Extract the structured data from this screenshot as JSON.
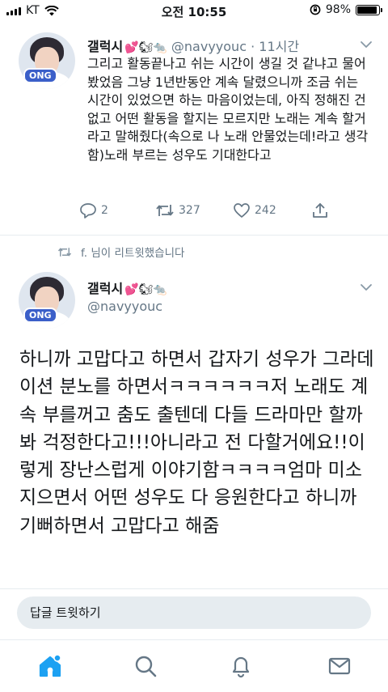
{
  "status_bar": {
    "carrier": "KT",
    "time": "오전 10:55",
    "battery": "98%",
    "battery_level": 0.98
  },
  "tweet": {
    "author_name": "갤럭시",
    "author_emoji": "💕🐿🐀",
    "handle": "@navyyouc",
    "time_separator": "·",
    "time_ago": "11시간",
    "avatar_badge": "ONG",
    "body": "그리고 활동끝나고 쉬는 시간이 생길 것 같냐고 물어봤었음 그냥 1년반동안 계속 달렸으니까 조금 쉬는 시간이 있었으면 하는 마음이었는데, 아직 정해진 건 없고 어떤 활동을 할지는 모르지만 노래는 계속 할거라고 말해줬다(속으로 나 노래 안물었는데!라고 생각함)노래 부르는 성우도 기대한다고",
    "reply_count": "2",
    "retweet_count": "327",
    "like_count": "242"
  },
  "retweet_notice": "f. 님이 리트윗했습니다",
  "main_tweet": {
    "author_name": "갤럭시",
    "author_emoji": "💕🐿🐀",
    "handle": "@navyyouc",
    "avatar_badge": "ONG",
    "body": "하니까 고맙다고 하면서 갑자기 성우가 그라데이션 분노를 하면서ㅋㅋㅋㅋㅋㅋ저 노래도 계속 부를꺼고 춤도 출텐데 다들 드라마만 할까봐 걱정한다고!!!아니라고 전 다할거에요!!이렇게 장난스럽게 이야기함ㅋㅋㅋㅋ엄마 미소지으면서 어떤 성우도 다 응원한다고 하니까 기뻐하면서 고맙다고 해줌"
  },
  "reply_placeholder": "답글 트윗하기",
  "tabbar": {
    "items": [
      "home-icon",
      "search-icon",
      "notifications-icon",
      "messages-icon"
    ],
    "active": "home-icon"
  },
  "colors": {
    "accent": "#1da1f2",
    "muted": "#657786",
    "text": "#14171a",
    "divider": "#e6ecf0"
  }
}
